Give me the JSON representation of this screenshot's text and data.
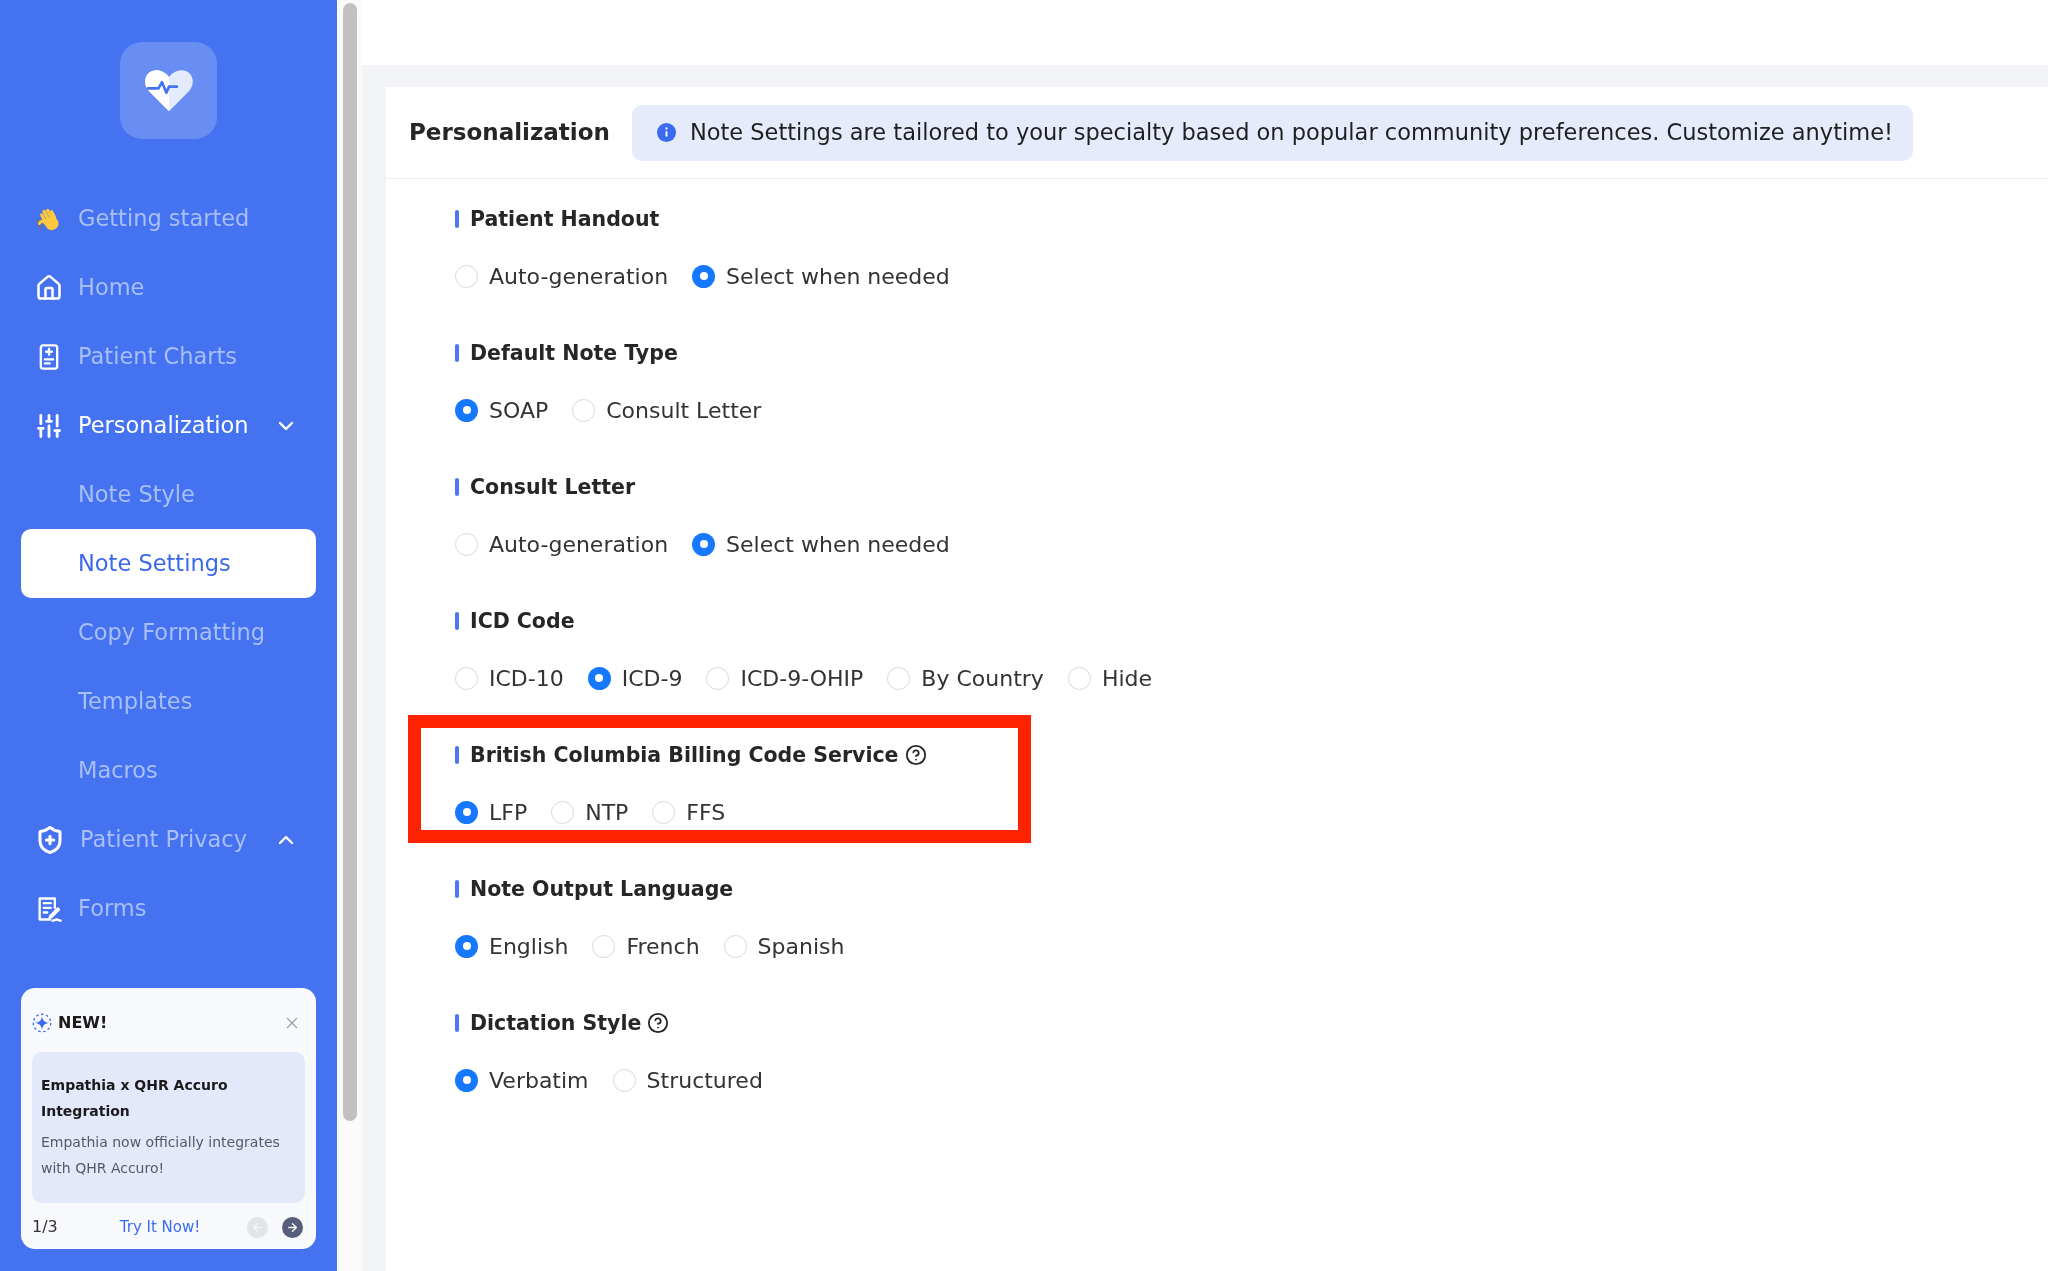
{
  "sidebar": {
    "items": [
      {
        "kind": "link",
        "label": "Getting started",
        "selected": false
      },
      {
        "kind": "link",
        "label": "Home",
        "selected": false
      },
      {
        "kind": "link",
        "label": "Patient Charts",
        "selected": false
      },
      {
        "kind": "group",
        "label": "Personalization",
        "selected": true,
        "expanded": true,
        "children": [
          {
            "label": "Note Style",
            "selected": false
          },
          {
            "label": "Note Settings",
            "selected": true
          },
          {
            "label": "Copy Formatting",
            "selected": false
          },
          {
            "label": "Templates",
            "selected": false
          },
          {
            "label": "Macros",
            "selected": false
          }
        ]
      },
      {
        "kind": "group",
        "label": "Patient Privacy",
        "selected": false,
        "expanded": false
      },
      {
        "kind": "link",
        "label": "Forms",
        "selected": false
      }
    ]
  },
  "promo": {
    "badge": "NEW!",
    "title": "Empathia x QHR Accuro Integration",
    "body": "Empathia now officially integrates with QHR Accuro!",
    "pager": "1/3",
    "action": "Try It Now!",
    "prev_disabled": true,
    "next_disabled": false
  },
  "header": {
    "title": "Personalization",
    "notice": "Note Settings are tailored to your specialty based on popular community preferences. Customize anytime!"
  },
  "sections": [
    {
      "title": "Patient Handout",
      "help": false,
      "highlighted": false,
      "options": [
        {
          "label": "Auto-generation",
          "selected": false
        },
        {
          "label": "Select when needed",
          "selected": true
        }
      ]
    },
    {
      "title": "Default Note Type",
      "help": false,
      "highlighted": false,
      "options": [
        {
          "label": "SOAP",
          "selected": true
        },
        {
          "label": "Consult Letter",
          "selected": false
        }
      ]
    },
    {
      "title": "Consult Letter",
      "help": false,
      "highlighted": false,
      "options": [
        {
          "label": "Auto-generation",
          "selected": false
        },
        {
          "label": "Select when needed",
          "selected": true
        }
      ]
    },
    {
      "title": "ICD Code",
      "help": false,
      "highlighted": false,
      "options": [
        {
          "label": "ICD-10",
          "selected": false
        },
        {
          "label": "ICD-9",
          "selected": true
        },
        {
          "label": "ICD-9-OHIP",
          "selected": false
        },
        {
          "label": "By Country",
          "selected": false
        },
        {
          "label": "Hide",
          "selected": false
        }
      ]
    },
    {
      "title": "British Columbia Billing Code Service",
      "help": true,
      "highlighted": true,
      "options": [
        {
          "label": "LFP",
          "selected": true
        },
        {
          "label": "NTP",
          "selected": false
        },
        {
          "label": "FFS",
          "selected": false
        }
      ]
    },
    {
      "title": "Note Output Language",
      "help": false,
      "highlighted": false,
      "options": [
        {
          "label": "English",
          "selected": true
        },
        {
          "label": "French",
          "selected": false
        },
        {
          "label": "Spanish",
          "selected": false
        }
      ]
    },
    {
      "title": "Dictation Style",
      "help": true,
      "highlighted": false,
      "options": [
        {
          "label": "Verbatim",
          "selected": true
        },
        {
          "label": "Structured",
          "selected": false
        }
      ]
    }
  ]
}
